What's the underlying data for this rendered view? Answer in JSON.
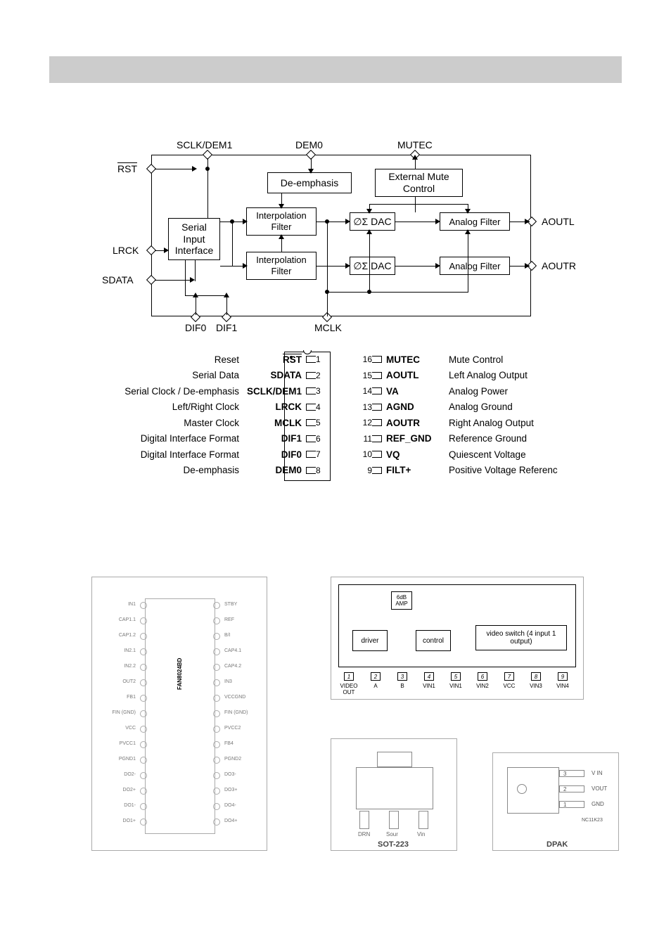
{
  "header": {
    "title": ""
  },
  "block_diagram": {
    "top_pins": {
      "sclk": "SCLK/DEM1",
      "dem0": "DEM0",
      "mutec": "MUTEC"
    },
    "left_pins": {
      "rst": "RST",
      "lrck": "LRCK",
      "sdata": "SDATA"
    },
    "bot_pins": {
      "dif0": "DIF0",
      "dif1": "DIF1",
      "mclk": "MCLK"
    },
    "right_pins": {
      "aoutl": "AOUTL",
      "aoutr": "AOUTR"
    },
    "boxes": {
      "serial": "Serial\nInput\nInterface",
      "deemp": "De-emphasis",
      "ext": "External\nMute Control",
      "int1": "Interpolation\nFilter",
      "int2": "Interpolation\nFilter",
      "dac1": "∅Σ DAC",
      "dac2": "∅Σ DAC",
      "af1": "Analog Filter",
      "af2": "Analog Filter"
    }
  },
  "pinout": {
    "left": [
      {
        "desc": "Reset",
        "name": "RST",
        "n": "1",
        "overline": true
      },
      {
        "desc": "Serial Data",
        "name": "SDATA",
        "n": "2"
      },
      {
        "desc": "Serial Clock / De-emphasis",
        "name": "SCLK/DEM1",
        "n": "3"
      },
      {
        "desc": "Left/Right Clock",
        "name": "LRCK",
        "n": "4"
      },
      {
        "desc": "Master Clock",
        "name": "MCLK",
        "n": "5"
      },
      {
        "desc": "Digital Interface Format",
        "name": "DIF1",
        "n": "6"
      },
      {
        "desc": "Digital Interface Format",
        "name": "DIF0",
        "n": "7"
      },
      {
        "desc": "De-emphasis",
        "name": "DEM0",
        "n": "8"
      }
    ],
    "right": [
      {
        "n": "16",
        "name": "MUTEC",
        "desc": "Mute Control"
      },
      {
        "n": "15",
        "name": "AOUTL",
        "desc": "Left Analog Output"
      },
      {
        "n": "14",
        "name": "VA",
        "desc": "Analog Power"
      },
      {
        "n": "13",
        "name": "AGND",
        "desc": "Analog Ground"
      },
      {
        "n": "12",
        "name": "AOUTR",
        "desc": "Right Analog Output"
      },
      {
        "n": "11",
        "name": "REF_GND",
        "desc": "Reference Ground"
      },
      {
        "n": "10",
        "name": "VQ",
        "desc": "Quiescent Voltage"
      },
      {
        "n": "9",
        "name": "FILT+",
        "desc": "Positive Voltage Referenc"
      }
    ]
  },
  "fan8024": {
    "chip": "FAN8024BD",
    "left_pins": [
      "IN1",
      "CAP1.1",
      "CAP1.2",
      "IN2.1",
      "IN2.2",
      "OUT2",
      "FB1",
      "FIN\n(GND)",
      "VCC",
      "PVCC1",
      "PGND1",
      "DO2-",
      "DO2+",
      "DO1-",
      "DO1+"
    ],
    "right_pins": [
      "STBY",
      "REF",
      "B/I",
      "CAP4.1",
      "CAP4.2",
      "IN3",
      "VCCGND",
      "FIN\n(GND)",
      "PVCC2",
      "FB4",
      "PGND2",
      "DO3-",
      "DO3+",
      "DO4-",
      "DO4+"
    ]
  },
  "video_switch": {
    "amp": "6dB\nAMP",
    "driver": "driver",
    "control": "control",
    "switch": "video switch\n(4 input 1 output)",
    "pins": [
      {
        "n": "1",
        "l": "VIDEO OUT"
      },
      {
        "n": "2",
        "l": "A"
      },
      {
        "n": "3",
        "l": "B"
      },
      {
        "n": "4",
        "l": "VIN1"
      },
      {
        "n": "5",
        "l": "VIN1"
      },
      {
        "n": "6",
        "l": "VIN2"
      },
      {
        "n": "7",
        "l": "VCC"
      },
      {
        "n": "8",
        "l": "VIN3"
      },
      {
        "n": "9",
        "l": "VIN4"
      }
    ]
  },
  "packages": {
    "sot223": "SOT-223",
    "sot223_pins": {
      "drn": "DRN",
      "sour": "Sour",
      "vin": "Vin"
    },
    "dpak": "DPAK",
    "dpak_note": "NC11K23",
    "dpak_pins": {
      "p1": "1",
      "p2": "2",
      "p3": "3",
      "vin": "V IN",
      "vout": "VOUT",
      "gnd": "GND"
    }
  }
}
